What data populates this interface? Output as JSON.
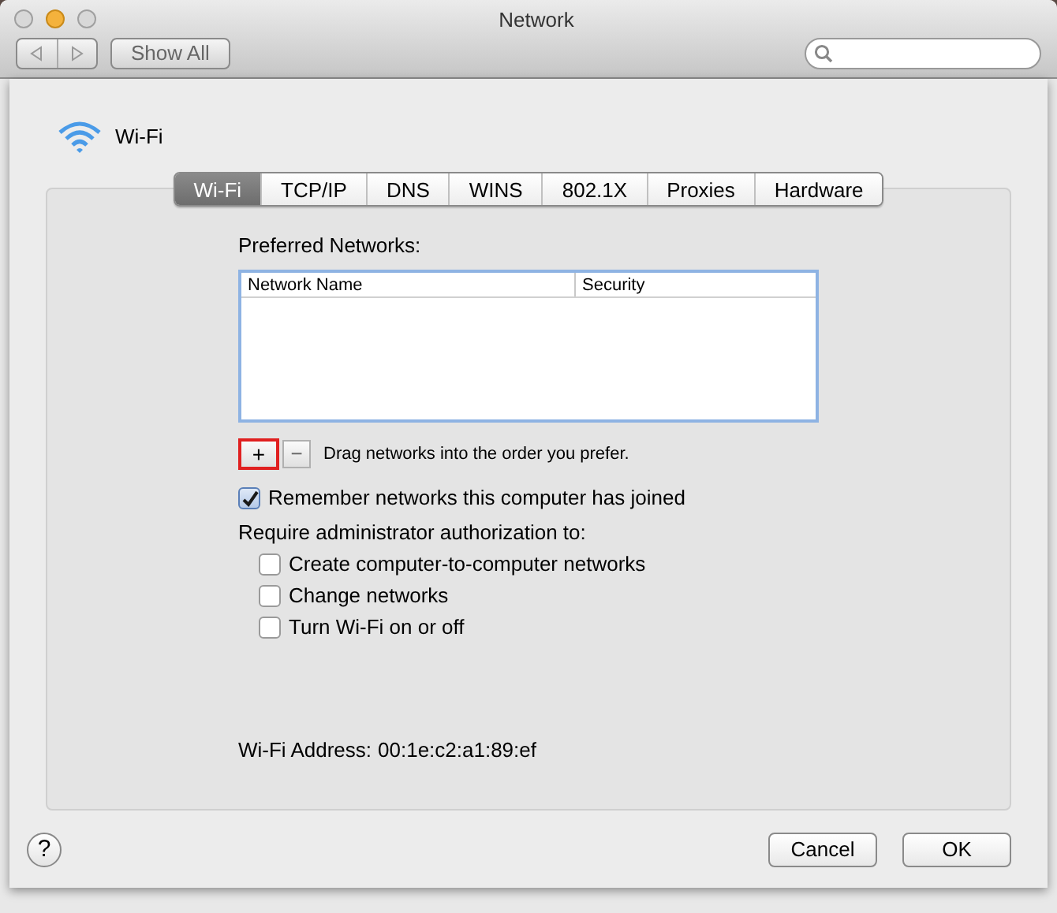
{
  "window": {
    "title": "Network"
  },
  "toolbar": {
    "show_all": "Show All"
  },
  "sheet": {
    "service": "Wi-Fi",
    "tabs": [
      {
        "label": "Wi-Fi",
        "selected": true
      },
      {
        "label": "TCP/IP",
        "selected": false
      },
      {
        "label": "DNS",
        "selected": false
      },
      {
        "label": "WINS",
        "selected": false
      },
      {
        "label": "802.1X",
        "selected": false
      },
      {
        "label": "Proxies",
        "selected": false
      },
      {
        "label": "Hardware",
        "selected": false
      }
    ],
    "preferred_networks": {
      "label": "Preferred Networks:",
      "columns": [
        "Network Name",
        "Security"
      ]
    },
    "add_button": "+",
    "remove_button": "−",
    "drag_hint": "Drag networks into the order you prefer.",
    "remember": {
      "label": "Remember networks this computer has joined",
      "checked": true
    },
    "require_label": "Require administrator authorization to:",
    "options": [
      {
        "label": "Create computer-to-computer networks",
        "checked": false
      },
      {
        "label": "Change networks",
        "checked": false
      },
      {
        "label": "Turn Wi-Fi on or off",
        "checked": false
      }
    ],
    "address_label": "Wi-Fi Address:",
    "address": "00:1e:c2:a1:89:ef",
    "help": "?",
    "buttons": [
      "Cancel",
      "OK"
    ]
  }
}
